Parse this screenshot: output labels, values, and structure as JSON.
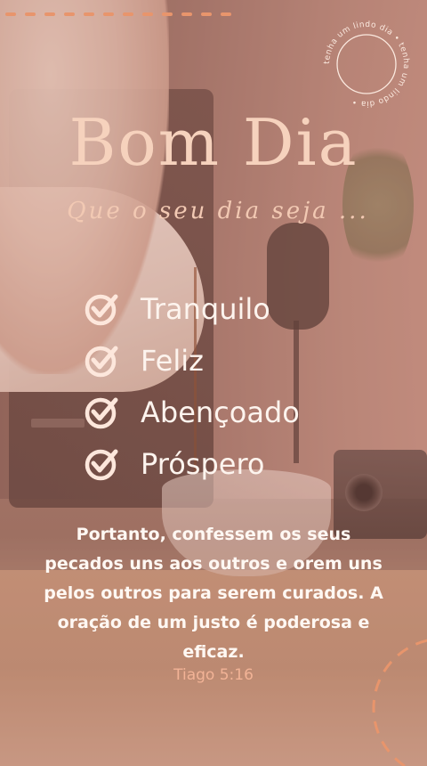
{
  "badge": {
    "ring_text": "tenha um lindo dia • tenha um lindo dia •"
  },
  "title": "Bom Dia",
  "subtitle": "Que o seu dia seja ...",
  "items": [
    {
      "label": "Tranquilo"
    },
    {
      "label": "Feliz"
    },
    {
      "label": "Abençoado"
    },
    {
      "label": "Próspero"
    }
  ],
  "verse": {
    "text": "Portanto, confessem os seus pecados uns aos outros e orem uns pelos outros para serem curados. A oração de um justo é poderosa e eficaz.",
    "reference": "Tiago 5:16"
  },
  "colors": {
    "accent": "#e8956c",
    "title": "#f6d2bd",
    "text": "#fdf4ee"
  },
  "icons": [
    "check-circle-icon"
  ]
}
